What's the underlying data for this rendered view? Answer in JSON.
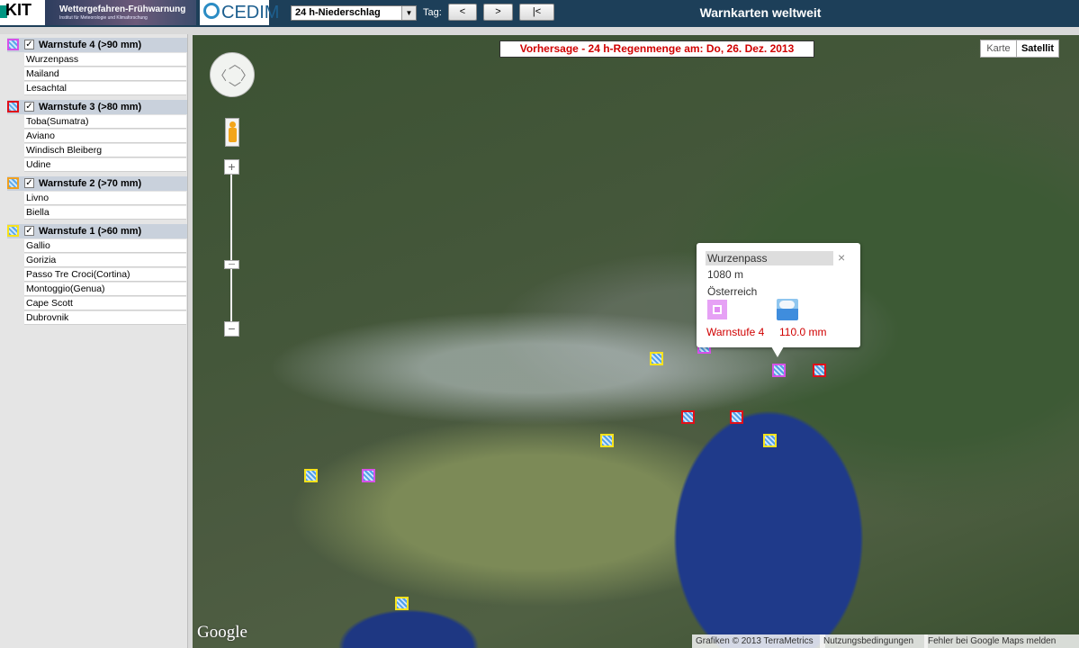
{
  "header": {
    "kit_logo": "KIT",
    "banner_title": "Wettergefahren-Frühwarnung",
    "banner_subtitle": "Institut für Meteorologie und Klimaforschung",
    "cedim_logo": "CEDIM",
    "product_select": "24 h-Niederschlag",
    "tag_label": "Tag:",
    "prev_button": "<",
    "next_button": ">",
    "first_button": "|<",
    "title": "Warnkarten weltweit"
  },
  "sidebar": {
    "groups": [
      {
        "label": "Warnstufe 4 (>90 mm)",
        "color": "#d651e8",
        "items": [
          "Wurzenpass",
          "Mailand",
          "Lesachtal"
        ]
      },
      {
        "label": "Warnstufe 3 (>80 mm)",
        "color": "#e0101a",
        "items": [
          "Toba(Sumatra)",
          "Aviano",
          "Windisch Bleiberg",
          "Udine"
        ]
      },
      {
        "label": "Warnstufe 2 (>70 mm)",
        "color": "#f0a020",
        "items": [
          "Livno",
          "Biella"
        ]
      },
      {
        "label": "Warnstufe 1 (>60 mm)",
        "color": "#f7e21b",
        "items": [
          "Gallio",
          "Gorizia",
          "Passo Tre Croci(Cortina)",
          "Montoggio(Genua)",
          "Cape Scott",
          "Dubrovnik"
        ]
      }
    ],
    "check_mark": "✓"
  },
  "map": {
    "forecast_banner": "Vorhersage - 24 h-Regenmenge am: Do, 26. Dez. 2013",
    "map_type_karte": "Karte",
    "map_type_satellit": "Satellit",
    "zoom_in": "+",
    "zoom_out": "−",
    "popup": {
      "name": "Wurzenpass",
      "altitude": "1080 m",
      "country": "Österreich",
      "level": "Warnstufe 4",
      "amount": "110.0  mm",
      "close": "×"
    },
    "google_logo": "Google",
    "footer": {
      "copyright": "Grafiken © 2013 TerraMetrics",
      "terms": "Nutzungsbedingungen",
      "report": "Fehler bei Google Maps melden"
    }
  }
}
